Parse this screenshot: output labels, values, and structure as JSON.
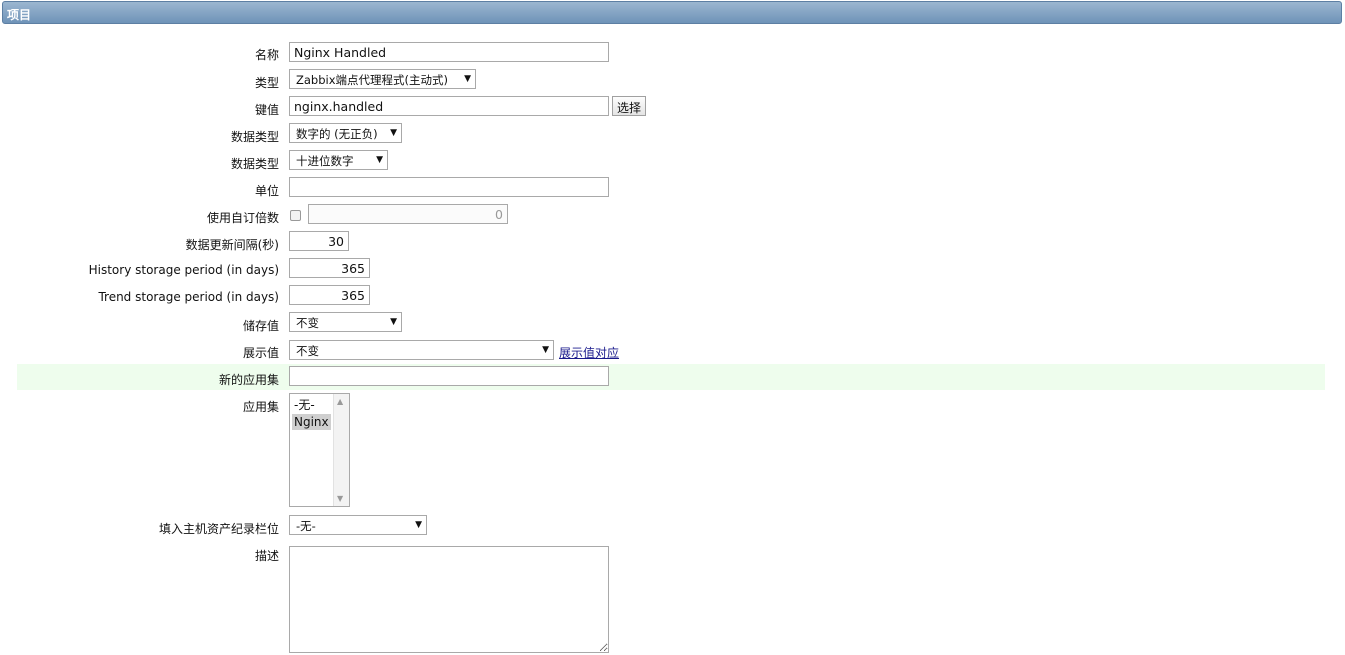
{
  "header": {
    "title": "项目"
  },
  "form": {
    "name": {
      "label": "名称",
      "value": "Nginx Handled"
    },
    "type": {
      "label": "类型",
      "selected": "Zabbix端点代理程式(主动式)"
    },
    "key": {
      "label": "键值",
      "value": "nginx.handled",
      "button": "选择"
    },
    "value_type": {
      "label": "数据类型",
      "selected": "数字的 (无正负)"
    },
    "data_format": {
      "label": "数据类型",
      "selected": "十进位数字"
    },
    "units": {
      "label": "单位",
      "value": ""
    },
    "multiplier": {
      "label": "使用自订倍数",
      "checked": false,
      "value": "0"
    },
    "interval": {
      "label": "数据更新间隔(秒)",
      "value": "30"
    },
    "history": {
      "label": "History storage period (in days)",
      "value": "365"
    },
    "trends": {
      "label": "Trend storage period (in days)",
      "value": "365"
    },
    "store_value": {
      "label": "储存值",
      "selected": "不变"
    },
    "show_value": {
      "label": "展示值",
      "selected": "不变",
      "link": "展示值对应"
    },
    "new_application": {
      "label": "新的应用集",
      "value": ""
    },
    "applications": {
      "label": "应用集",
      "options": [
        "-无-",
        "Nginx"
      ],
      "selected_index": 1
    },
    "inventory_link": {
      "label": "填入主机资产纪录栏位",
      "selected": "-无-"
    },
    "description": {
      "label": "描述",
      "value": ""
    }
  }
}
